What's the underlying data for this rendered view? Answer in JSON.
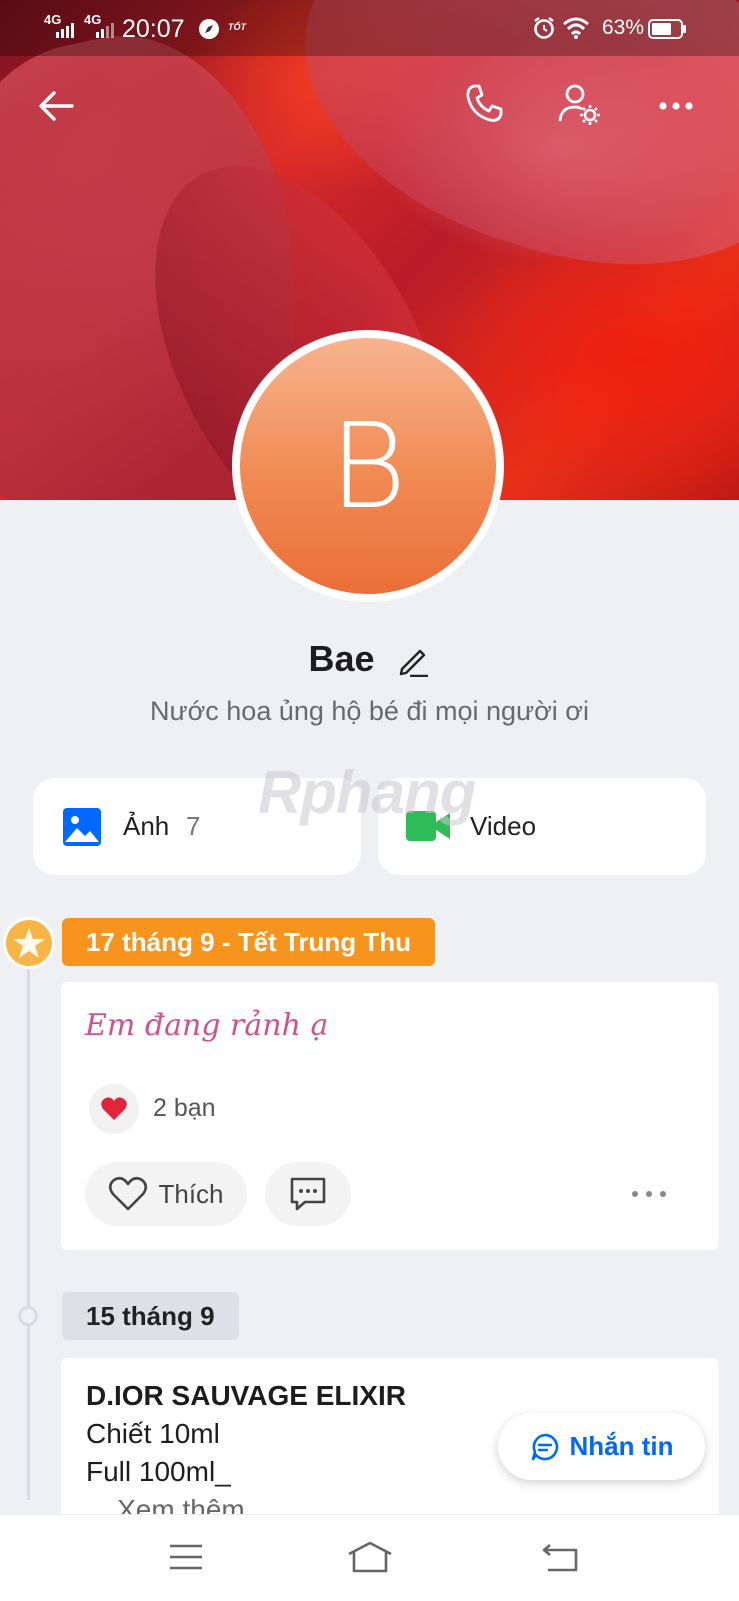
{
  "status_bar": {
    "network1": "4G",
    "network2": "4G",
    "time": "20:07",
    "carrier_tag": "TỐT",
    "battery": "63%"
  },
  "profile": {
    "avatar_letter": "B",
    "name": "Bae",
    "bio": "Nước hoa ủng hộ bé đi mọi người ơi"
  },
  "media_tiles": {
    "photos_label": "Ảnh",
    "photos_count": "7",
    "video_label": "Video"
  },
  "watermark": "Rphang",
  "timeline": {
    "events": [
      {
        "date": "17 tháng 9 - Tết Trung Thu",
        "text": "Em đang rảnh ạ",
        "reaction_count": "2 bạn",
        "like_label": "Thích"
      },
      {
        "date": "15 tháng 9",
        "title": "D.IOR SAUVAGE ELIXIR",
        "line1": "Chiết 10ml",
        "line2": "Full 100ml_",
        "more": "... Xem thêm"
      }
    ]
  },
  "fab": {
    "label": "Nhắn tin"
  },
  "colors": {
    "accent_orange": "#f7941d",
    "accent_blue": "#0068ff",
    "video_green": "#2dbc55",
    "post_pink": "#d4508a"
  }
}
